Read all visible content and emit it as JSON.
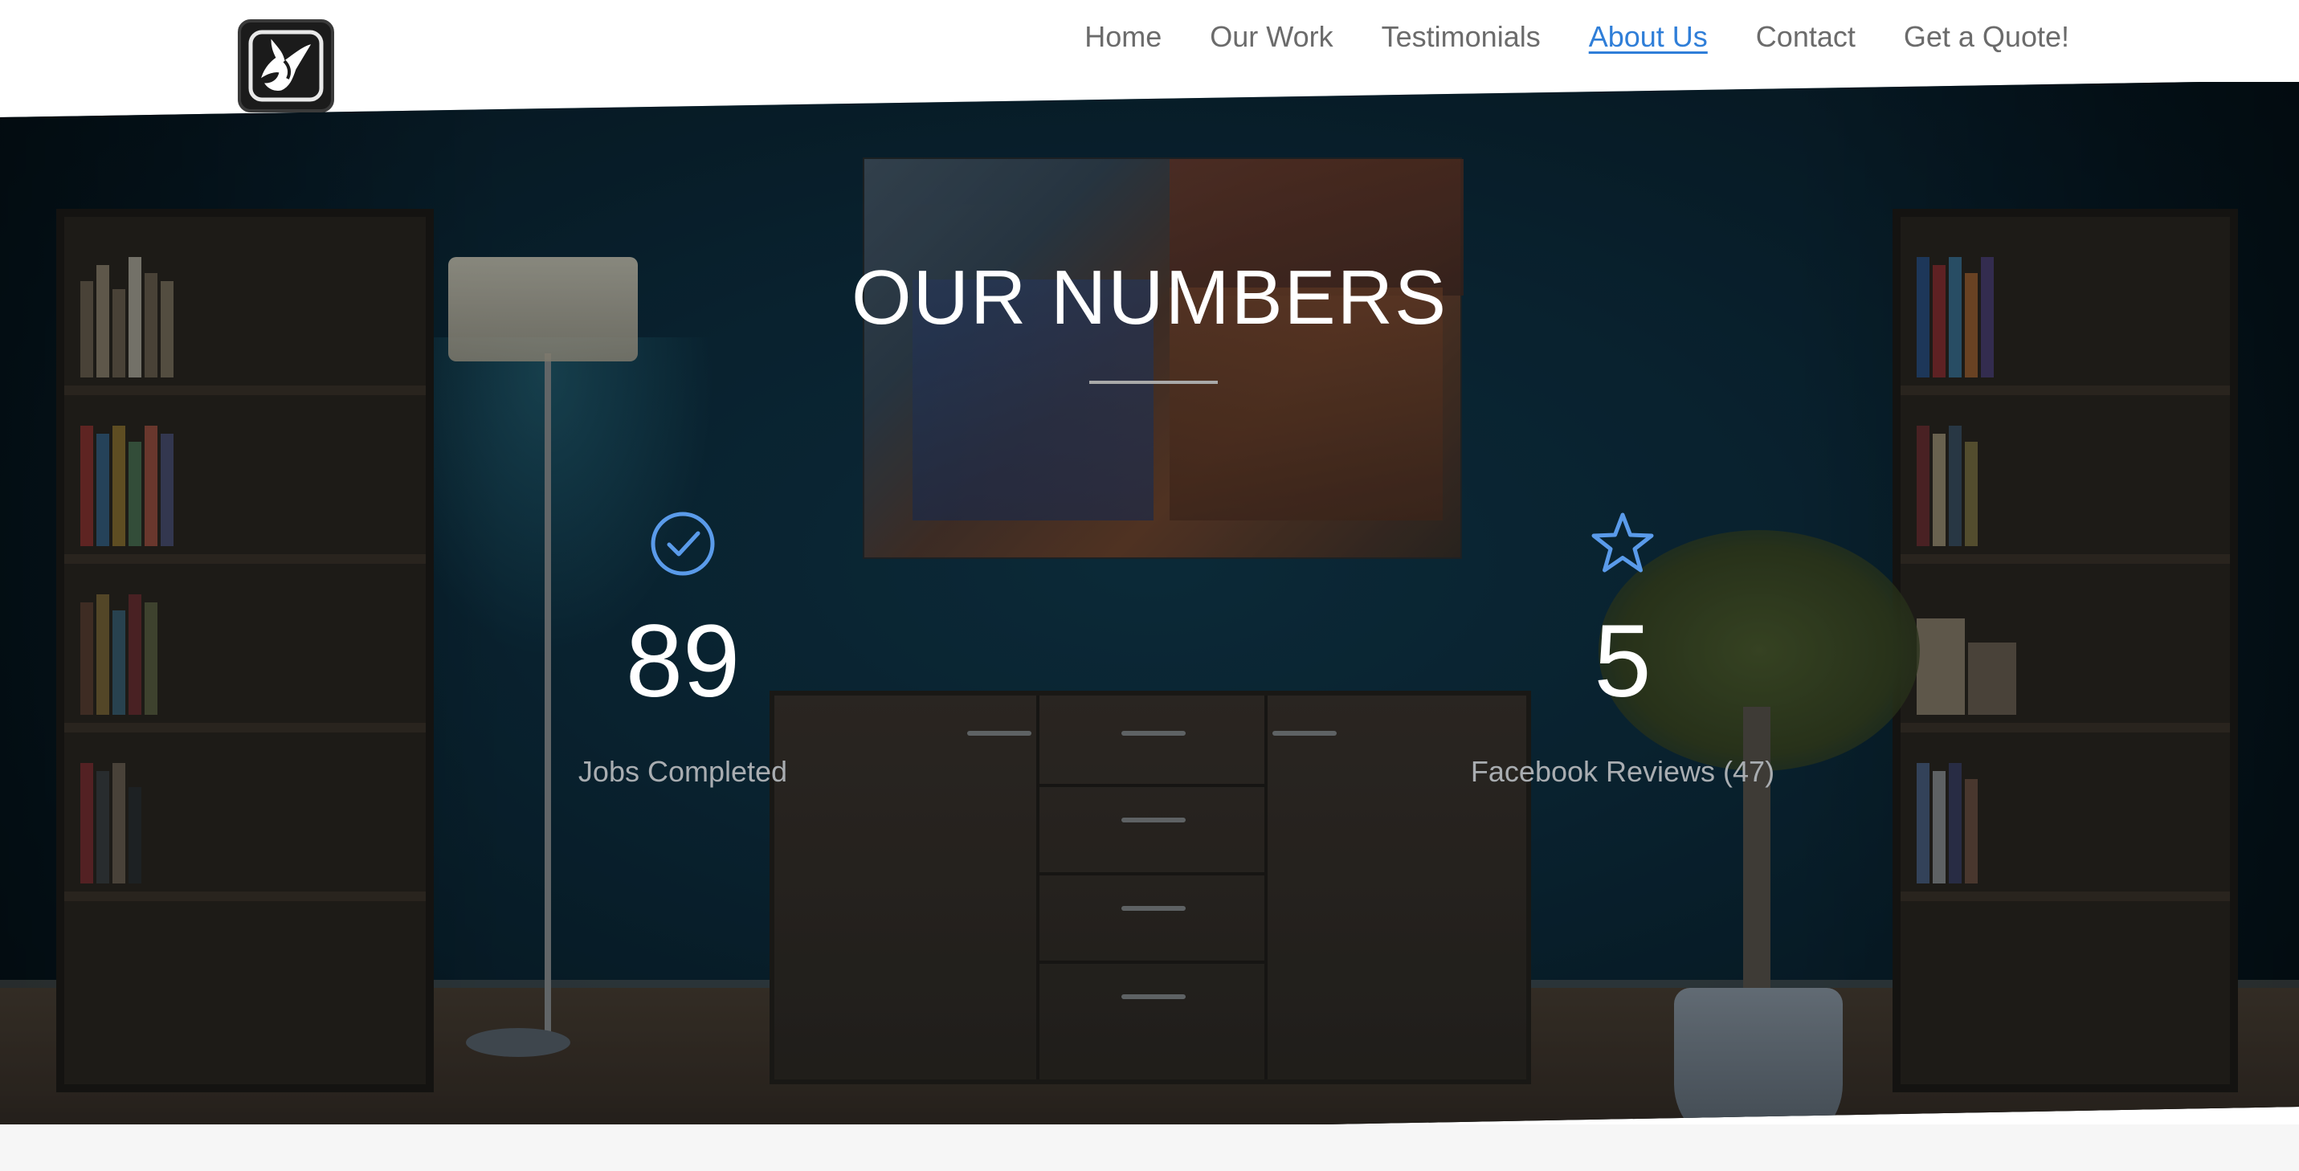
{
  "header": {
    "logo_icon": "stylized-animal-head-logo-icon",
    "nav": [
      {
        "label": "Home",
        "active": false
      },
      {
        "label": "Our Work",
        "active": false
      },
      {
        "label": "Testimonials",
        "active": false
      },
      {
        "label": "About Us",
        "active": true
      },
      {
        "label": "Contact",
        "active": false
      },
      {
        "label": "Get a Quote!",
        "active": false
      }
    ]
  },
  "hero": {
    "title": "OUR NUMBERS",
    "stats": [
      {
        "icon": "check-circle-icon",
        "value": "89",
        "label": "Jobs Completed"
      },
      {
        "icon": "star-outline-icon",
        "value": "5",
        "label": "Facebook Reviews (47)"
      }
    ]
  },
  "colors": {
    "accent": "#2f7ed8",
    "icon": "#5a9bea",
    "nav_text": "#6b6b6b",
    "hero_text": "#ffffff",
    "stat_label": "#a9adb1"
  }
}
